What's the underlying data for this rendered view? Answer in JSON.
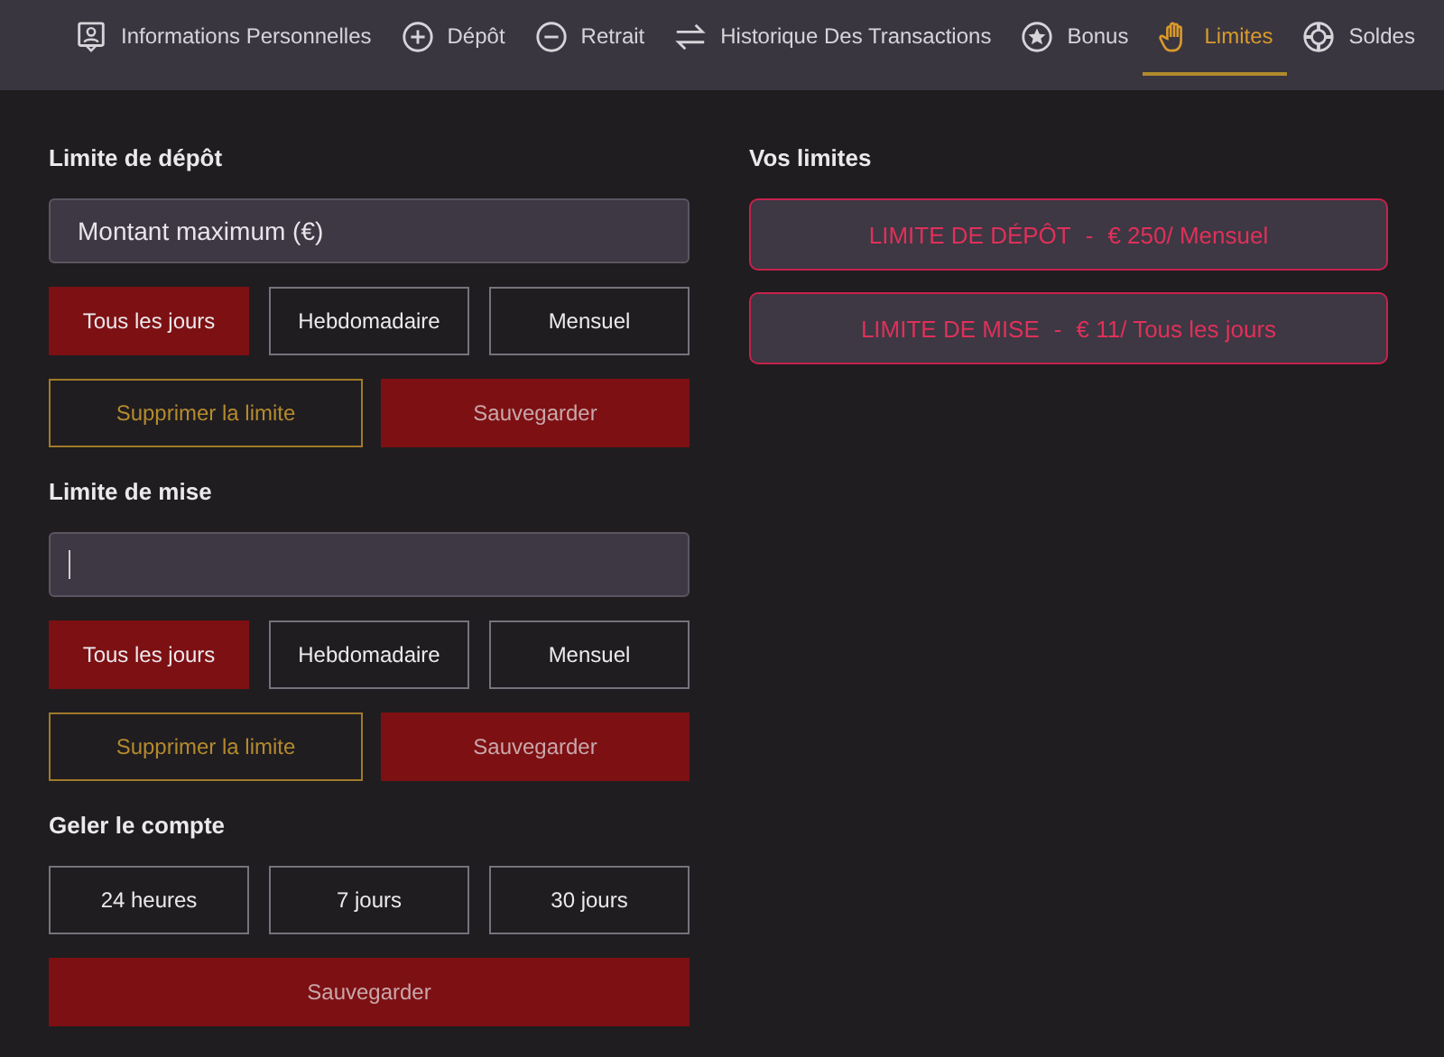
{
  "tabs": [
    {
      "label": "Informations Personnelles",
      "selected": false
    },
    {
      "label": "Dépôt",
      "selected": false
    },
    {
      "label": "Retrait",
      "selected": false
    },
    {
      "label": "Historique Des Transactions",
      "selected": false
    },
    {
      "label": "Bonus",
      "selected": false
    },
    {
      "label": "Limites",
      "selected": true
    },
    {
      "label": "Soldes",
      "selected": false
    }
  ],
  "sections": [
    {
      "title": "Limite de dépôt",
      "field": {
        "placeholder": "Montant maximum (€)",
        "focused": false
      },
      "periods": [
        {
          "label": "Tous les jours",
          "selected": true
        },
        {
          "label": "Hebdomadaire",
          "selected": false
        },
        {
          "label": "Mensuel",
          "selected": false
        }
      ],
      "actions": [
        "Supprimer la limite",
        "Sauvegarder"
      ]
    },
    {
      "title": "Limite de mise",
      "field": {
        "focused": true
      },
      "periods": [
        {
          "label": "Tous les jours",
          "selected": true
        },
        {
          "label": "Hebdomadaire",
          "selected": false
        },
        {
          "label": "Mensuel",
          "selected": false
        }
      ],
      "actions": [
        "Supprimer la limite",
        "Sauvegarder"
      ]
    }
  ],
  "freeze": {
    "title": "Geler le compte",
    "options": [
      "24 heures",
      "7 jours",
      "30 jours"
    ],
    "save": "Sauvegarder"
  },
  "limits": {
    "title": "Vos limites",
    "items": [
      {
        "name": "LIMITE DE DÉPÔT",
        "separator": "-",
        "value": "€ 250/ Mensuel"
      },
      {
        "name": "LIMITE DE MISE",
        "separator": "-",
        "value": "€ 11/ Tous les jours"
      }
    ]
  }
}
